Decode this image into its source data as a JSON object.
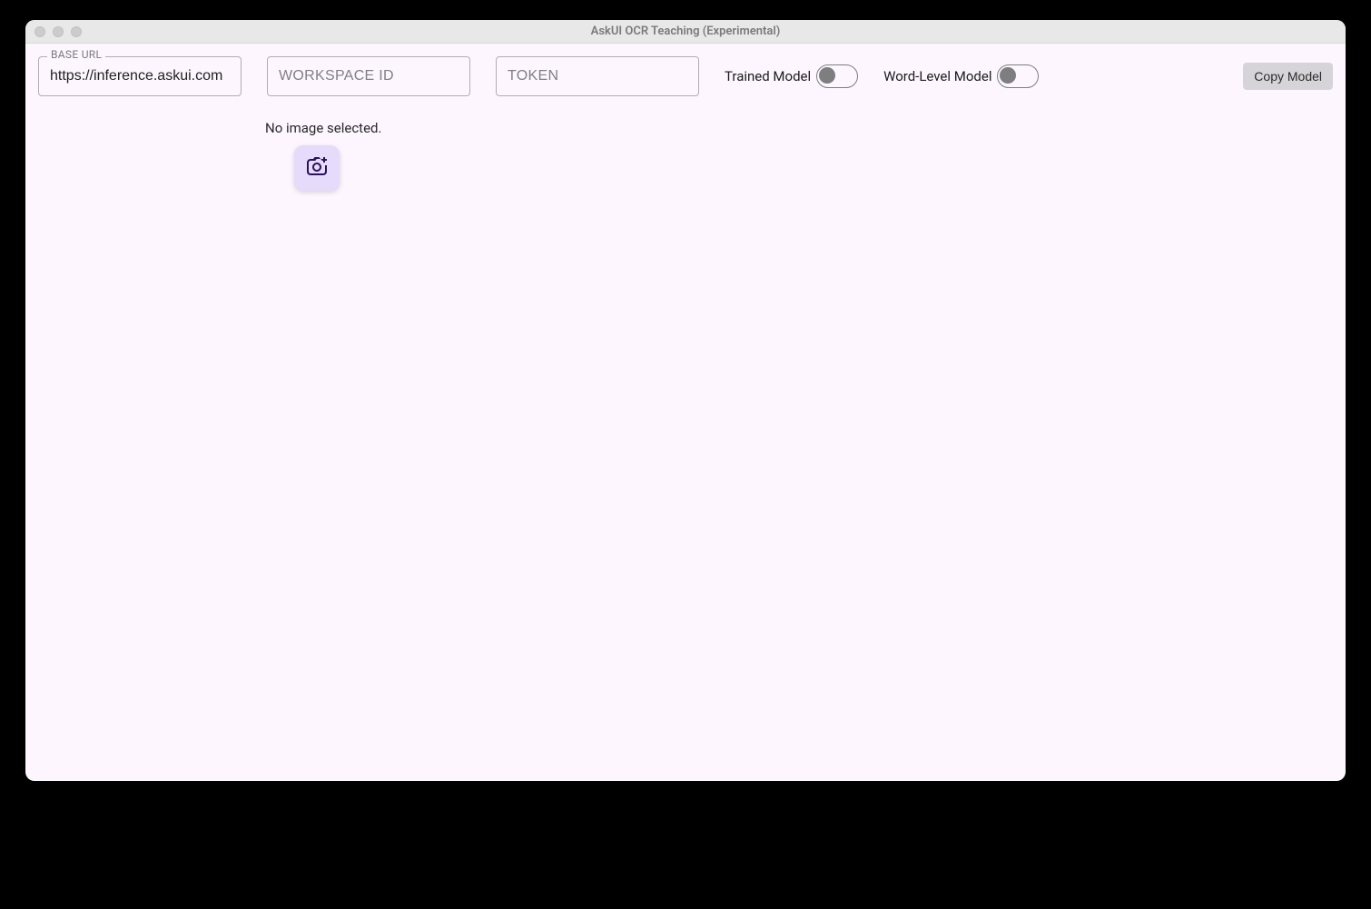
{
  "window": {
    "title": "AskUI OCR Teaching (Experimental)"
  },
  "toolbar": {
    "baseUrl": {
      "label": "BASE URL",
      "value": "https://inference.askui.com"
    },
    "workspaceId": {
      "placeholder": "Workspace ID",
      "value": ""
    },
    "token": {
      "placeholder": "Token",
      "value": ""
    },
    "trainedModel": {
      "label": "Trained Model",
      "on": false
    },
    "wordLevelModel": {
      "label": "Word-Level Model",
      "on": false
    },
    "copyModel": {
      "label": "Copy Model"
    }
  },
  "imageZone": {
    "status": "No image selected."
  }
}
